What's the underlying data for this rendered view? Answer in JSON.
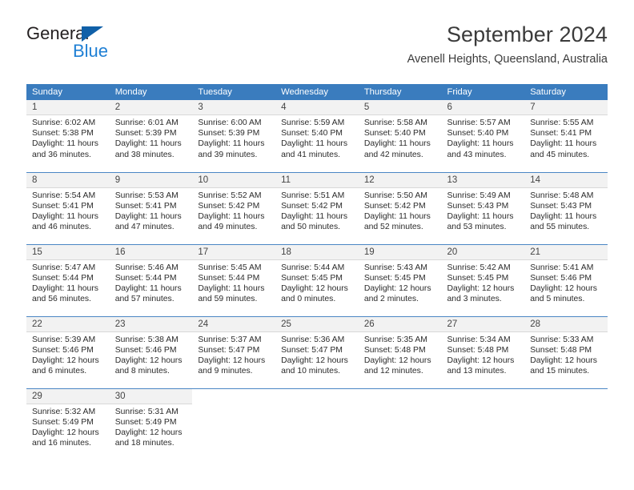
{
  "logo": {
    "word_top": "General",
    "word_bottom": "Blue",
    "triangle_icon": "triangle-icon",
    "brand_blue": "#1e7fd4",
    "triangle_blue": "#1060a8"
  },
  "header": {
    "title": "September 2024",
    "subtitle": "Avenell Heights, Queensland, Australia"
  },
  "theme": {
    "header_row_bg": "#3a7cbe",
    "header_row_text": "#ffffff",
    "daynum_bg": "#f2f2f2",
    "row_divider": "#4a86c4",
    "body_text": "#2b2b2b"
  },
  "calendar": {
    "weekday_headers": [
      "Sunday",
      "Monday",
      "Tuesday",
      "Wednesday",
      "Thursday",
      "Friday",
      "Saturday"
    ],
    "weeks": [
      [
        {
          "day": "1",
          "sunrise": "Sunrise: 6:02 AM",
          "sunset": "Sunset: 5:38 PM",
          "daylight_1": "Daylight: 11 hours",
          "daylight_2": "and 36 minutes."
        },
        {
          "day": "2",
          "sunrise": "Sunrise: 6:01 AM",
          "sunset": "Sunset: 5:39 PM",
          "daylight_1": "Daylight: 11 hours",
          "daylight_2": "and 38 minutes."
        },
        {
          "day": "3",
          "sunrise": "Sunrise: 6:00 AM",
          "sunset": "Sunset: 5:39 PM",
          "daylight_1": "Daylight: 11 hours",
          "daylight_2": "and 39 minutes."
        },
        {
          "day": "4",
          "sunrise": "Sunrise: 5:59 AM",
          "sunset": "Sunset: 5:40 PM",
          "daylight_1": "Daylight: 11 hours",
          "daylight_2": "and 41 minutes."
        },
        {
          "day": "5",
          "sunrise": "Sunrise: 5:58 AM",
          "sunset": "Sunset: 5:40 PM",
          "daylight_1": "Daylight: 11 hours",
          "daylight_2": "and 42 minutes."
        },
        {
          "day": "6",
          "sunrise": "Sunrise: 5:57 AM",
          "sunset": "Sunset: 5:40 PM",
          "daylight_1": "Daylight: 11 hours",
          "daylight_2": "and 43 minutes."
        },
        {
          "day": "7",
          "sunrise": "Sunrise: 5:55 AM",
          "sunset": "Sunset: 5:41 PM",
          "daylight_1": "Daylight: 11 hours",
          "daylight_2": "and 45 minutes."
        }
      ],
      [
        {
          "day": "8",
          "sunrise": "Sunrise: 5:54 AM",
          "sunset": "Sunset: 5:41 PM",
          "daylight_1": "Daylight: 11 hours",
          "daylight_2": "and 46 minutes."
        },
        {
          "day": "9",
          "sunrise": "Sunrise: 5:53 AM",
          "sunset": "Sunset: 5:41 PM",
          "daylight_1": "Daylight: 11 hours",
          "daylight_2": "and 47 minutes."
        },
        {
          "day": "10",
          "sunrise": "Sunrise: 5:52 AM",
          "sunset": "Sunset: 5:42 PM",
          "daylight_1": "Daylight: 11 hours",
          "daylight_2": "and 49 minutes."
        },
        {
          "day": "11",
          "sunrise": "Sunrise: 5:51 AM",
          "sunset": "Sunset: 5:42 PM",
          "daylight_1": "Daylight: 11 hours",
          "daylight_2": "and 50 minutes."
        },
        {
          "day": "12",
          "sunrise": "Sunrise: 5:50 AM",
          "sunset": "Sunset: 5:42 PM",
          "daylight_1": "Daylight: 11 hours",
          "daylight_2": "and 52 minutes."
        },
        {
          "day": "13",
          "sunrise": "Sunrise: 5:49 AM",
          "sunset": "Sunset: 5:43 PM",
          "daylight_1": "Daylight: 11 hours",
          "daylight_2": "and 53 minutes."
        },
        {
          "day": "14",
          "sunrise": "Sunrise: 5:48 AM",
          "sunset": "Sunset: 5:43 PM",
          "daylight_1": "Daylight: 11 hours",
          "daylight_2": "and 55 minutes."
        }
      ],
      [
        {
          "day": "15",
          "sunrise": "Sunrise: 5:47 AM",
          "sunset": "Sunset: 5:44 PM",
          "daylight_1": "Daylight: 11 hours",
          "daylight_2": "and 56 minutes."
        },
        {
          "day": "16",
          "sunrise": "Sunrise: 5:46 AM",
          "sunset": "Sunset: 5:44 PM",
          "daylight_1": "Daylight: 11 hours",
          "daylight_2": "and 57 minutes."
        },
        {
          "day": "17",
          "sunrise": "Sunrise: 5:45 AM",
          "sunset": "Sunset: 5:44 PM",
          "daylight_1": "Daylight: 11 hours",
          "daylight_2": "and 59 minutes."
        },
        {
          "day": "18",
          "sunrise": "Sunrise: 5:44 AM",
          "sunset": "Sunset: 5:45 PM",
          "daylight_1": "Daylight: 12 hours",
          "daylight_2": "and 0 minutes."
        },
        {
          "day": "19",
          "sunrise": "Sunrise: 5:43 AM",
          "sunset": "Sunset: 5:45 PM",
          "daylight_1": "Daylight: 12 hours",
          "daylight_2": "and 2 minutes."
        },
        {
          "day": "20",
          "sunrise": "Sunrise: 5:42 AM",
          "sunset": "Sunset: 5:45 PM",
          "daylight_1": "Daylight: 12 hours",
          "daylight_2": "and 3 minutes."
        },
        {
          "day": "21",
          "sunrise": "Sunrise: 5:41 AM",
          "sunset": "Sunset: 5:46 PM",
          "daylight_1": "Daylight: 12 hours",
          "daylight_2": "and 5 minutes."
        }
      ],
      [
        {
          "day": "22",
          "sunrise": "Sunrise: 5:39 AM",
          "sunset": "Sunset: 5:46 PM",
          "daylight_1": "Daylight: 12 hours",
          "daylight_2": "and 6 minutes."
        },
        {
          "day": "23",
          "sunrise": "Sunrise: 5:38 AM",
          "sunset": "Sunset: 5:46 PM",
          "daylight_1": "Daylight: 12 hours",
          "daylight_2": "and 8 minutes."
        },
        {
          "day": "24",
          "sunrise": "Sunrise: 5:37 AM",
          "sunset": "Sunset: 5:47 PM",
          "daylight_1": "Daylight: 12 hours",
          "daylight_2": "and 9 minutes."
        },
        {
          "day": "25",
          "sunrise": "Sunrise: 5:36 AM",
          "sunset": "Sunset: 5:47 PM",
          "daylight_1": "Daylight: 12 hours",
          "daylight_2": "and 10 minutes."
        },
        {
          "day": "26",
          "sunrise": "Sunrise: 5:35 AM",
          "sunset": "Sunset: 5:48 PM",
          "daylight_1": "Daylight: 12 hours",
          "daylight_2": "and 12 minutes."
        },
        {
          "day": "27",
          "sunrise": "Sunrise: 5:34 AM",
          "sunset": "Sunset: 5:48 PM",
          "daylight_1": "Daylight: 12 hours",
          "daylight_2": "and 13 minutes."
        },
        {
          "day": "28",
          "sunrise": "Sunrise: 5:33 AM",
          "sunset": "Sunset: 5:48 PM",
          "daylight_1": "Daylight: 12 hours",
          "daylight_2": "and 15 minutes."
        }
      ],
      [
        {
          "day": "29",
          "sunrise": "Sunrise: 5:32 AM",
          "sunset": "Sunset: 5:49 PM",
          "daylight_1": "Daylight: 12 hours",
          "daylight_2": "and 16 minutes."
        },
        {
          "day": "30",
          "sunrise": "Sunrise: 5:31 AM",
          "sunset": "Sunset: 5:49 PM",
          "daylight_1": "Daylight: 12 hours",
          "daylight_2": "and 18 minutes."
        },
        {
          "day": "",
          "sunrise": "",
          "sunset": "",
          "daylight_1": "",
          "daylight_2": ""
        },
        {
          "day": "",
          "sunrise": "",
          "sunset": "",
          "daylight_1": "",
          "daylight_2": ""
        },
        {
          "day": "",
          "sunrise": "",
          "sunset": "",
          "daylight_1": "",
          "daylight_2": ""
        },
        {
          "day": "",
          "sunrise": "",
          "sunset": "",
          "daylight_1": "",
          "daylight_2": ""
        },
        {
          "day": "",
          "sunrise": "",
          "sunset": "",
          "daylight_1": "",
          "daylight_2": ""
        }
      ]
    ]
  }
}
